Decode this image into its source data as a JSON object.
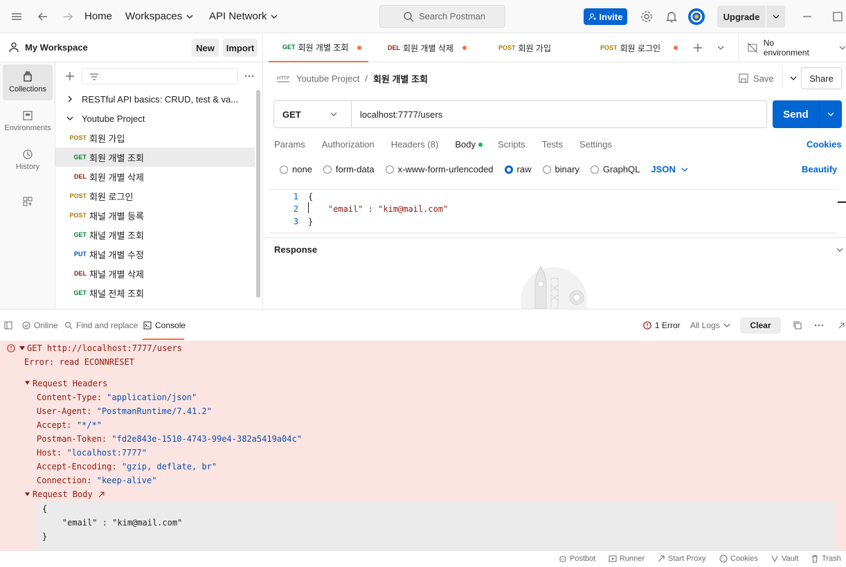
{
  "nav": {
    "home": "Home",
    "workspaces": "Workspaces",
    "api_network": "API Network",
    "search_placeholder": "Search Postman",
    "invite": "Invite",
    "upgrade": "Upgrade"
  },
  "workspace": {
    "title": "My Workspace",
    "new": "New",
    "import": "Import"
  },
  "rail": [
    {
      "label": "Collections"
    },
    {
      "label": "Environments"
    },
    {
      "label": "History"
    }
  ],
  "tree": {
    "collections": [
      {
        "name": "RESTful API basics: CRUD, test & va..."
      },
      {
        "name": "Youtube Project"
      }
    ],
    "requests": [
      {
        "method": "POST",
        "name": "회원 가입"
      },
      {
        "method": "GET",
        "name": "회원 개별 조회"
      },
      {
        "method": "DEL",
        "name": "회원 개별 삭제"
      },
      {
        "method": "POST",
        "name": "회원 로그인"
      },
      {
        "method": "POST",
        "name": "채널 개별 등록"
      },
      {
        "method": "GET",
        "name": "채널 개별 조회"
      },
      {
        "method": "PUT",
        "name": "채널 개별 수정"
      },
      {
        "method": "DEL",
        "name": "채널 개별 삭제"
      },
      {
        "method": "GET",
        "name": "채널 전체 조회"
      }
    ]
  },
  "tabs": [
    {
      "method": "GET",
      "name": "회원 개별 조회"
    },
    {
      "method": "DEL",
      "name": "회원 개별 삭제"
    },
    {
      "method": "POST",
      "name": "회원 가입"
    },
    {
      "method": "POST",
      "name": "회원 로그인"
    }
  ],
  "environment": "No environment",
  "request": {
    "breadcrumb_parent": "Youtube Project",
    "breadcrumb_sep": "/",
    "title": "회원 개별 조회",
    "save": "Save",
    "share": "Share",
    "method": "GET",
    "url": "localhost:7777/users",
    "send": "Send",
    "tabs": [
      "Params",
      "Authorization",
      "Headers (8)",
      "Body",
      "Scripts",
      "Tests",
      "Settings"
    ],
    "cookies": "Cookies",
    "body_options": [
      "none",
      "form-data",
      "x-www-form-urlencoded",
      "raw",
      "binary",
      "GraphQL"
    ],
    "body_format": "JSON",
    "beautify": "Beautify",
    "code_lines": [
      "{",
      "    \"email\" : \"kim@mail.com\"",
      "}"
    ],
    "line_numbers": [
      "1",
      "2",
      "3"
    ]
  },
  "response": {
    "title": "Response"
  },
  "console_bar": {
    "online": "Online",
    "find_replace": "Find and replace",
    "console": "Console",
    "errors": "1 Error",
    "logs": "All Logs",
    "clear": "Clear"
  },
  "console": {
    "request_line": "GET http://localhost:7777/users",
    "error": "Error: read ECONNRESET",
    "headers_title": "Request Headers",
    "headers": [
      {
        "key": "Content-Type:",
        "value": "\"application/json\""
      },
      {
        "key": "User-Agent:",
        "value": "\"PostmanRuntime/7.41.2\""
      },
      {
        "key": "Accept:",
        "value": "\"*/*\""
      },
      {
        "key": "Postman-Token:",
        "value": "\"fd2e843e-1510-4743-99e4-382a5419a04c\""
      },
      {
        "key": "Host:",
        "value": "\"localhost:7777\""
      },
      {
        "key": "Accept-Encoding:",
        "value": "\"gzip, deflate, br\""
      },
      {
        "key": "Connection:",
        "value": "\"keep-alive\""
      }
    ],
    "body_title": "Request Body",
    "body_lines": [
      "{",
      "    \"email\" : \"kim@mail.com\"",
      "}"
    ]
  },
  "statusbar": [
    "Postbot",
    "Runner",
    "Start Proxy",
    "Cookies",
    "Vault",
    "Trash"
  ],
  "colors": {
    "accent": "#ff6c37",
    "primary": "#0265d2",
    "error_bg": "#fbe4e1"
  }
}
